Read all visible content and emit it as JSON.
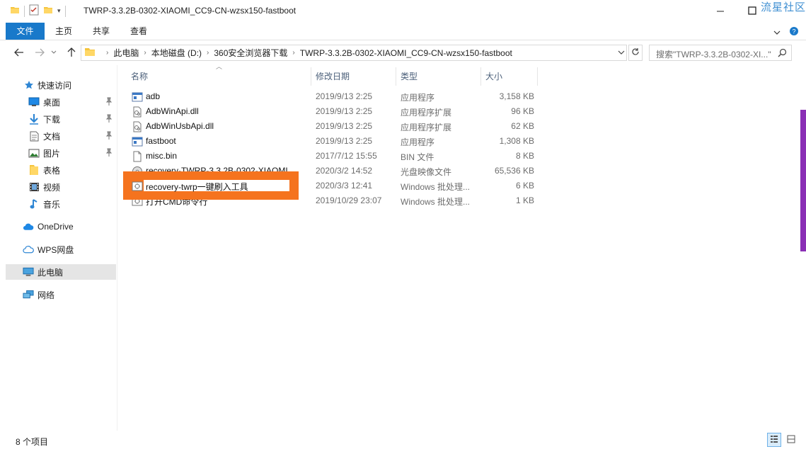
{
  "window": {
    "title": "TWRP-3.3.2B-0302-XIAOMI_CC9-CN-wzsx150-fastboot",
    "watermark": "流星社区"
  },
  "ribbon": {
    "tabs": [
      "文件",
      "主页",
      "共享",
      "查看"
    ]
  },
  "address": {
    "crumbs": [
      "此电脑",
      "本地磁盘 (D:)",
      "360安全浏览器下载",
      "TWRP-3.3.2B-0302-XIAOMI_CC9-CN-wzsx150-fastboot"
    ]
  },
  "search": {
    "placeholder": "搜索\"TWRP-3.3.2B-0302-XI...\""
  },
  "sidebar": {
    "items": [
      {
        "label": "快速访问",
        "icon": "star-icon"
      },
      {
        "label": "桌面",
        "icon": "desktop-icon",
        "pinned": true
      },
      {
        "label": "下载",
        "icon": "download-icon",
        "pinned": true
      },
      {
        "label": "文档",
        "icon": "document-icon",
        "pinned": true
      },
      {
        "label": "图片",
        "icon": "picture-icon",
        "pinned": true
      },
      {
        "label": "表格",
        "icon": "folder-icon"
      },
      {
        "label": "视频",
        "icon": "video-icon"
      },
      {
        "label": "音乐",
        "icon": "music-icon"
      },
      {
        "label": "OneDrive",
        "icon": "cloud-icon"
      },
      {
        "label": "WPS网盘",
        "icon": "wps-cloud-icon"
      },
      {
        "label": "此电脑",
        "icon": "computer-icon",
        "selected": true
      },
      {
        "label": "网络",
        "icon": "network-icon"
      }
    ]
  },
  "columns": {
    "name": "名称",
    "date": "修改日期",
    "type": "类型",
    "size": "大小"
  },
  "files": [
    {
      "name": "adb",
      "date": "2019/9/13 2:25",
      "type": "应用程序",
      "size": "3,158 KB",
      "icon": "exe-icon"
    },
    {
      "name": "AdbWinApi.dll",
      "date": "2019/9/13 2:25",
      "type": "应用程序扩展",
      "size": "96 KB",
      "icon": "dll-icon"
    },
    {
      "name": "AdbWinUsbApi.dll",
      "date": "2019/9/13 2:25",
      "type": "应用程序扩展",
      "size": "62 KB",
      "icon": "dll-icon"
    },
    {
      "name": "fastboot",
      "date": "2019/9/13 2:25",
      "type": "应用程序",
      "size": "1,308 KB",
      "icon": "exe-icon"
    },
    {
      "name": "misc.bin",
      "date": "2017/7/12 15:55",
      "type": "BIN 文件",
      "size": "8 KB",
      "icon": "file-icon"
    },
    {
      "name": "recovery-TWRP-3.3.2B-0302-XIAOMI...",
      "date": "2020/3/2 14:52",
      "type": "光盘映像文件",
      "size": "65,536 KB",
      "icon": "disc-icon"
    },
    {
      "name": "recovery-twrp一键刷入工具",
      "date": "2020/3/3 12:41",
      "type": "Windows 批处理...",
      "size": "6 KB",
      "icon": "bat-icon",
      "renaming": true
    },
    {
      "name": "打开CMD命令行",
      "date": "2019/10/29 23:07",
      "type": "Windows 批处理...",
      "size": "1 KB",
      "icon": "bat-icon"
    }
  ],
  "status": {
    "item_count": "8 个项目"
  },
  "colors": {
    "accent": "#1979ca",
    "highlight": "#f5731e",
    "selected_bg": "#e5e5e5"
  }
}
